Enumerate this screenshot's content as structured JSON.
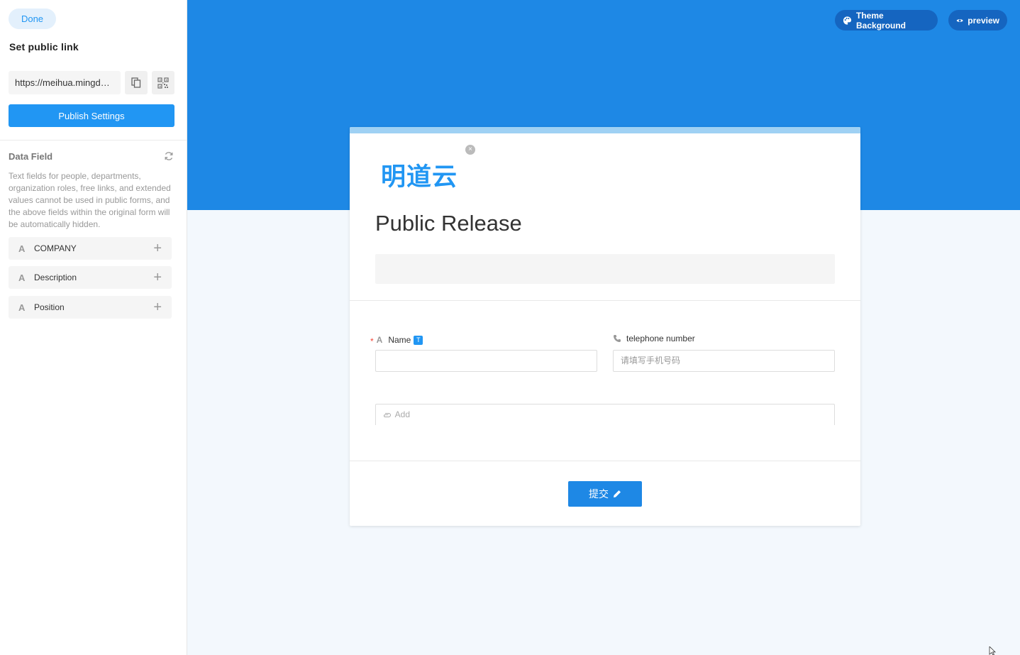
{
  "sidebar": {
    "done_label": "Done",
    "set_link_title": "Set public link",
    "public_url": "https://meihua.mingdao.com/public/form/...",
    "publish_settings_label": "Publish Settings",
    "data_field_title": "Data Field",
    "data_field_desc": "Text fields for people, departments, organization roles, free links, and extended values cannot be used in public forms, and the above fields within the original form will be automatically hidden.",
    "fields": [
      {
        "icon": "A",
        "label": "COMPANY"
      },
      {
        "icon": "A",
        "label": "Description"
      },
      {
        "icon": "A",
        "label": "Position"
      }
    ]
  },
  "header": {
    "theme_background_label": "Theme Background",
    "preview_label": "preview"
  },
  "form": {
    "logo_text": "明道云",
    "title": "Public Release",
    "fields": {
      "name": {
        "icon": "A",
        "label": "Name",
        "badge": "T",
        "required_mark": "*",
        "value": ""
      },
      "telephone": {
        "label": "telephone number",
        "placeholder": "请填写手机号码"
      }
    },
    "add_label": "Add",
    "submit_label": "提交"
  },
  "colors": {
    "primary": "#2196f3",
    "header_bg": "#1e88e5",
    "pill_bg": "#1565c0",
    "page_bg": "#f3f8fd",
    "card_topbar": "#9fd1f4"
  }
}
